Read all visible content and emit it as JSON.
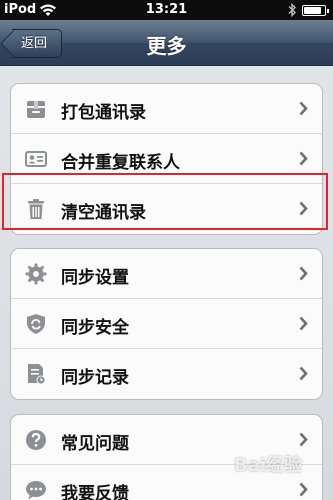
{
  "status_bar": {
    "carrier": "iPod",
    "time": "13:21",
    "battery_level": 0.85
  },
  "nav": {
    "back_label": "返回",
    "title": "更多"
  },
  "groups": [
    {
      "items": [
        {
          "label": "打包通讯录",
          "icon": "archive-box-icon"
        },
        {
          "label": "合并重复联系人",
          "icon": "contact-card-icon"
        },
        {
          "label": "清空通讯录",
          "icon": "trash-icon",
          "highlighted": true
        }
      ]
    },
    {
      "items": [
        {
          "label": "同步设置",
          "icon": "gear-icon"
        },
        {
          "label": "同步安全",
          "icon": "shield-sync-icon"
        },
        {
          "label": "同步记录",
          "icon": "log-document-icon"
        }
      ]
    },
    {
      "items": [
        {
          "label": "常见问题",
          "icon": "question-icon"
        },
        {
          "label": "我要反馈",
          "icon": "chat-bubble-icon"
        }
      ]
    }
  ],
  "colors": {
    "nav_bar": "#3c4e66",
    "highlight": "#e3232b",
    "background": "#dde1e6"
  },
  "watermark": "Bai经验"
}
